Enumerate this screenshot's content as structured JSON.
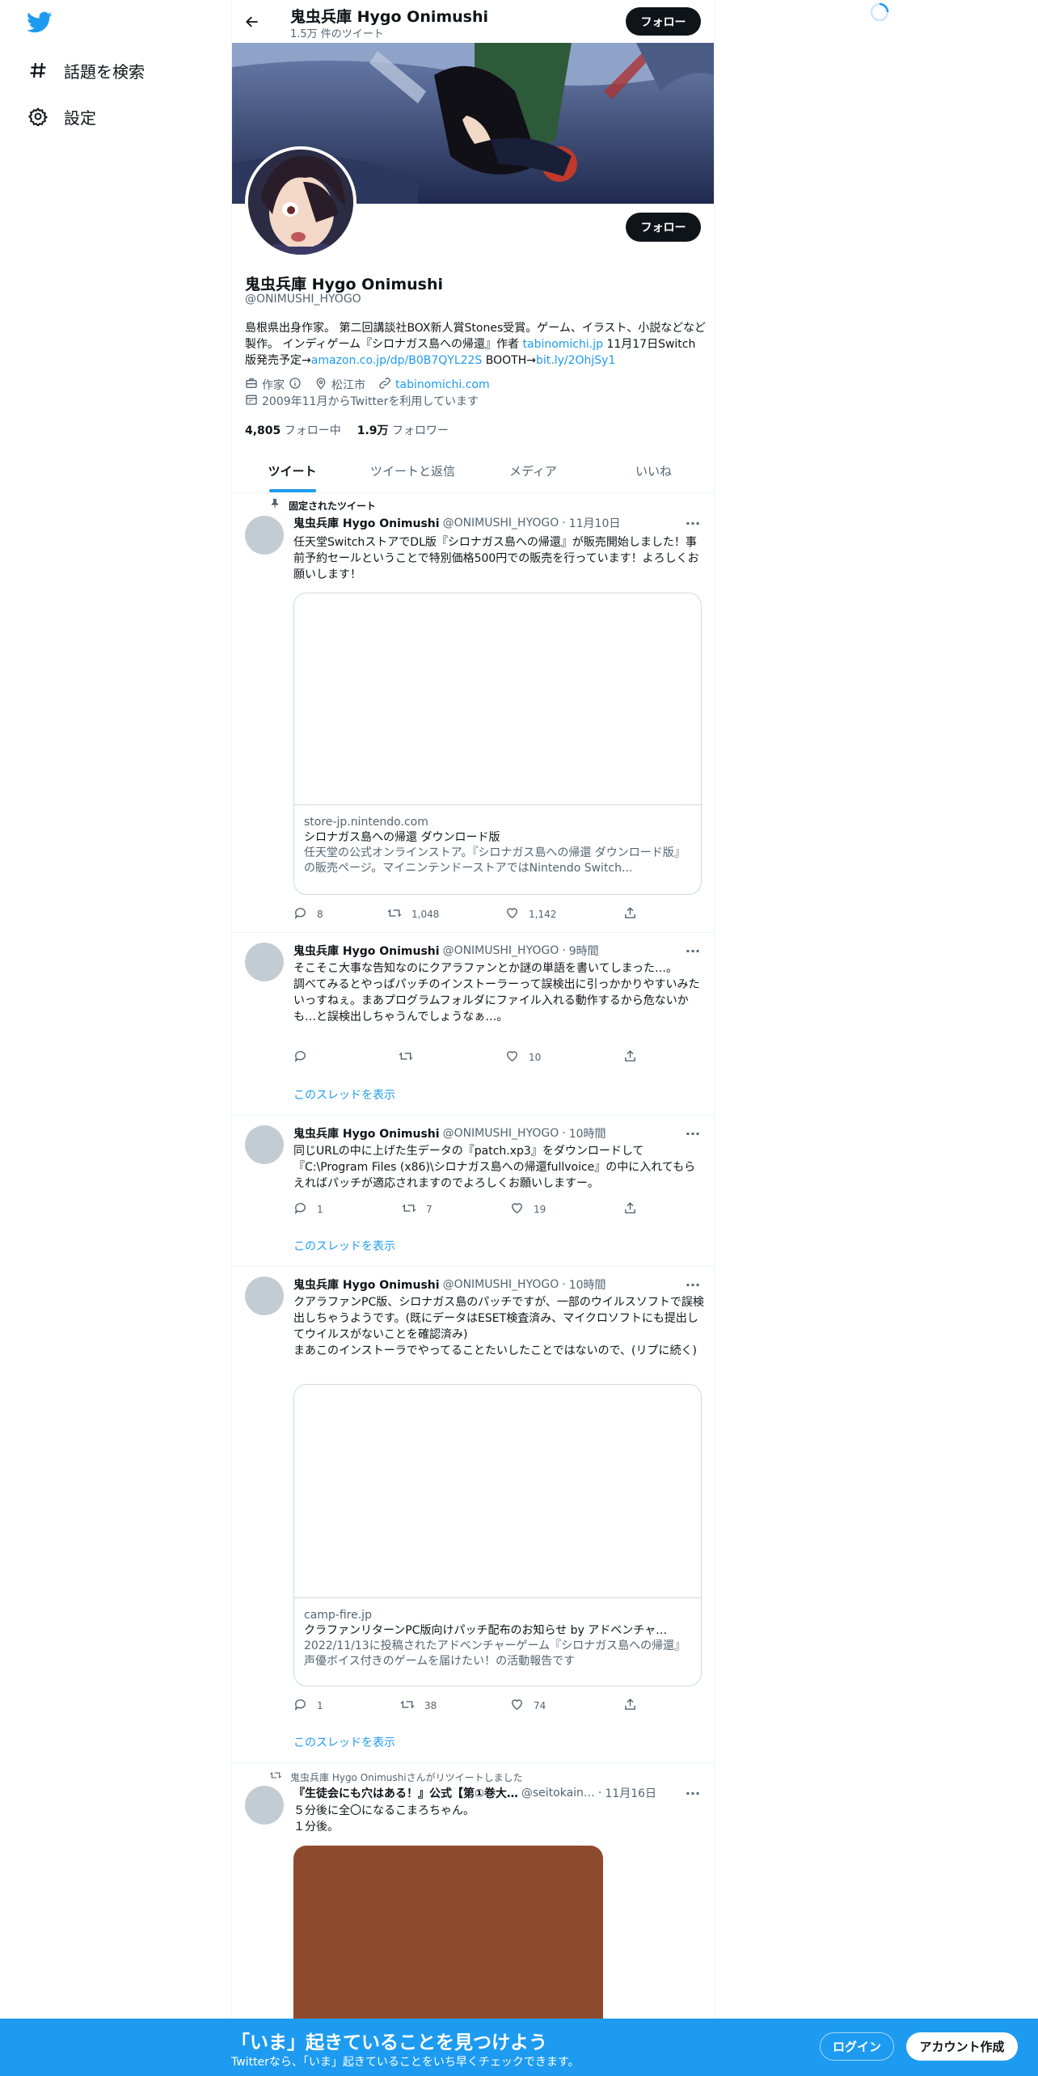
{
  "sidebar": {
    "items": [
      {
        "label": "話題を検索",
        "icon": "hash-icon"
      },
      {
        "label": "設定",
        "icon": "gear-icon"
      }
    ]
  },
  "header": {
    "title": "鬼虫兵庫 Hygo Onimushi",
    "tweet_count": "1.5万 件のツイート",
    "follow_label": "フォロー"
  },
  "profile": {
    "follow_label": "フォロー",
    "name": "鬼虫兵庫 Hygo Onimushi",
    "handle": "@ONIMUSHI_HYOGO",
    "bio_part1": "島根県出身作家。 第二回講談社BOX新人賞Stones受賞。ゲーム、イラスト、小説などなど製作。 インディゲーム『シロナガス島への帰還』作者 ",
    "bio_link1": "tabinomichi.jp",
    "bio_part2": " 11月17日Switch版発売予定→",
    "bio_link2": "amazon.co.jp/dp/B0B7QYL22S",
    "bio_part3": " BOOTH→",
    "bio_link3": "bit.ly/2OhjSy1",
    "profession": "作家",
    "location": "松江市",
    "website": "tabinomichi.com",
    "joined": "2009年11月からTwitterを利用しています",
    "following_count": "4,805",
    "following_label": "フォロー中",
    "followers_count": "1.9万",
    "followers_label": "フォロワー"
  },
  "tabs": [
    "ツイート",
    "ツイートと返信",
    "メディア",
    "いいね"
  ],
  "tweets": [
    {
      "context": "固定されたツイート",
      "name": "鬼虫兵庫 Hygo Onimushi",
      "handle": "@ONIMUSHI_HYOGO",
      "time": "11月10日",
      "text": "任天堂SwitchストアでDL版『シロナガス島への帰還』が販売開始しました！事前予約セールということで特別価格500円での販売を行っています！よろしくお願いします！",
      "card": {
        "domain": "store-jp.nintendo.com",
        "title": "シロナガス島への帰還 ダウンロード版",
        "desc": "任天堂の公式オンラインストア。『シロナガス島への帰還 ダウンロード版』の販売ページ。マイニンテンドーストアではNintendo Switch..."
      },
      "replies": "8",
      "retweets": "1,048",
      "likes": "1,142"
    },
    {
      "name": "鬼虫兵庫 Hygo Onimushi",
      "handle": "@ONIMUSHI_HYOGO",
      "time": "9時間",
      "text": "そこそこ大事な告知なのにクアラファンとか謎の単語を書いてしまった…。\n調べてみるとやっぱパッチのインストーラーって誤検出に引っかかりやすいみたいっすねぇ。まあプログラムフォルダにファイル入れる動作するから危ないかも…と誤検出しちゃうんでしょうなぁ…。",
      "replies": "",
      "retweets": "",
      "likes": "10",
      "thread": "このスレッドを表示"
    },
    {
      "name": "鬼虫兵庫 Hygo Onimushi",
      "handle": "@ONIMUSHI_HYOGO",
      "time": "10時間",
      "text": "同じURLの中に上げた生データの『patch.xp3』をダウンロードして『C:\\Program Files (x86)\\シロナガス島への帰還fullvoice』の中に入れてもらえればパッチが適応されますのでよろしくお願いしますー。",
      "replies": "1",
      "retweets": "7",
      "likes": "19",
      "thread": "このスレッドを表示"
    },
    {
      "name": "鬼虫兵庫 Hygo Onimushi",
      "handle": "@ONIMUSHI_HYOGO",
      "time": "10時間",
      "text": "クアラファンPC版、シロナガス島のパッチですが、一部のウイルスソフトで誤検出しちゃうようです。(既にデータはESET検査済み、マイクロソフトにも提出してウイルスがないことを確認済み)\nまあこのインストーラでやってることたいしたことではないので、(リプに続く)",
      "card": {
        "domain": "camp-fire.jp",
        "title": "クラファンリターンPC版向けパッチ配布のお知らせ by アドベンチャ…",
        "desc": "2022/11/13に投稿されたアドベンチャーゲーム『シロナガス島への帰還』声優ボイス付きのゲームを届けたい！の活動報告です"
      },
      "replies": "1",
      "retweets": "38",
      "likes": "74",
      "thread": "このスレッドを表示"
    },
    {
      "context": "鬼虫兵庫 Hygo Onimushiさんがリツイートしました",
      "name": "『生徒会にも穴はある！』公式【第①巻大…",
      "handle": "@seitokain…",
      "time": "11月16日",
      "text": "５分後に全〇になるこまろちゃん。\n１分後。"
    }
  ],
  "bottom_bar": {
    "title": "「いま」起きていることを見つけよう",
    "subtitle": "Twitterなら、「いま」起きていることをいち早くチェックできます。",
    "login_label": "ログイン",
    "signup_label": "アカウント作成"
  },
  "colors": {
    "accent": "#1d9bf0",
    "text": "#0f1419",
    "secondary": "#536471",
    "media_placeholder": "#8e4a2d"
  }
}
